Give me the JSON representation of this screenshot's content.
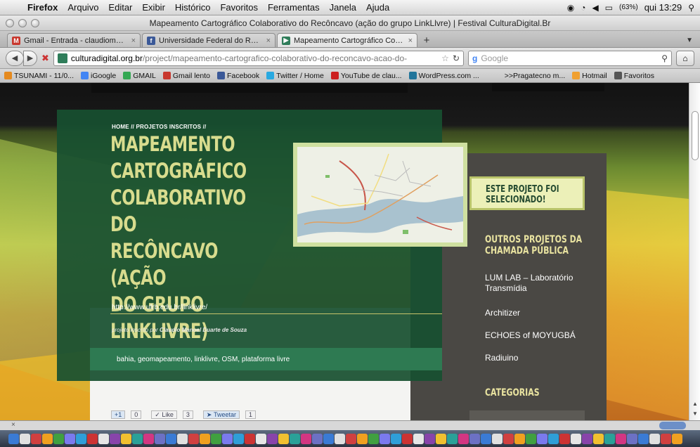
{
  "menubar": {
    "app": "Firefox",
    "items": [
      "Arquivo",
      "Editar",
      "Exibir",
      "Histórico",
      "Favoritos",
      "Ferramentas",
      "Janela",
      "Ajuda"
    ],
    "battery": "(63%)",
    "clock": "qui 13:29"
  },
  "window": {
    "title": "Mapeamento Cartográfico Colaborativo do Recôncavo (ação do grupo LinkLlvre) | Festival CulturaDigital.Br"
  },
  "tabs": [
    {
      "label": "Gmail - Entrada - claudiomano...",
      "icon": "gmail-icon",
      "color": "#c8372d",
      "active": false
    },
    {
      "label": "Universidade Federal do Recônc...",
      "icon": "facebook-icon",
      "color": "#3b5998",
      "active": false
    },
    {
      "label": "Mapeamento Cartográfico Cola...",
      "icon": "culturadigital-icon",
      "color": "#2f7d5a",
      "active": true
    }
  ],
  "nav": {
    "url_domain": "culturadigital.org.br",
    "url_path": "/project/mapeamento-cartografico-colaborativo-do-reconcavo-acao-do-",
    "search_placeholder": "Google"
  },
  "bookmarks": [
    {
      "label": "TSUNAMI - 11/0...",
      "icon": "rss-icon",
      "color": "#e58a1f"
    },
    {
      "label": "iGoogle",
      "icon": "google-icon",
      "color": "#4285f4"
    },
    {
      "label": "GMAIL",
      "icon": "google-icon",
      "color": "#34a853"
    },
    {
      "label": "Gmail lento",
      "icon": "gmail-icon",
      "color": "#c8372d"
    },
    {
      "label": "Facebook",
      "icon": "facebook-icon",
      "color": "#3b5998"
    },
    {
      "label": "Twitter / Home",
      "icon": "twitter-icon",
      "color": "#29a9e1"
    },
    {
      "label": "YouTube de clau...",
      "icon": "youtube-icon",
      "color": "#cc2020"
    },
    {
      "label": "WordPress.com ...",
      "icon": "wordpress-icon",
      "color": "#21759b"
    },
    {
      "label": ">>Pragatecno m...",
      "icon": "",
      "color": ""
    },
    {
      "label": "Hotmail",
      "icon": "hotmail-icon",
      "color": "#f0a030"
    },
    {
      "label": "Favoritos",
      "icon": "bookmarks-icon",
      "color": "#555555"
    }
  ],
  "page": {
    "breadcrumb": "HOME // PROJETOS INSCRITOS //",
    "headline": "MAPEAMENTO\nCARTOGRÁFICO\nCOLABORATIVO DO\nRECÔNCAVO (AÇÃO\nDO GRUPO\nLINKLIVRE)",
    "project_url": "http://www.ufrb.edu.br/linklivre/",
    "byline_prefix": "projeto inscrito por",
    "byline_author": "Claudio Manoel Duarte de Souza",
    "tags": "bahia, geomapeamento, linklivre, OSM, plataforma livre",
    "selected_label": "ESTE PROJETO FOI\nSELECIONADO!",
    "other_projects_heading": "OUTROS PROJETOS DA\nCHAMADA PÚBLICA",
    "other_projects": [
      "LUM LAB – Laboratório\nTransmídia",
      "Architizer",
      "ECHOES of MOYUGBÁ",
      "Radiuino"
    ],
    "categories_heading": "CATEGORIAS",
    "social": {
      "plusone": "+1",
      "plusone_count": "0",
      "like": "Like",
      "like_count": "3",
      "tweet": "Tweetar",
      "tweet_count": "1"
    }
  },
  "status": {
    "close": "×"
  }
}
